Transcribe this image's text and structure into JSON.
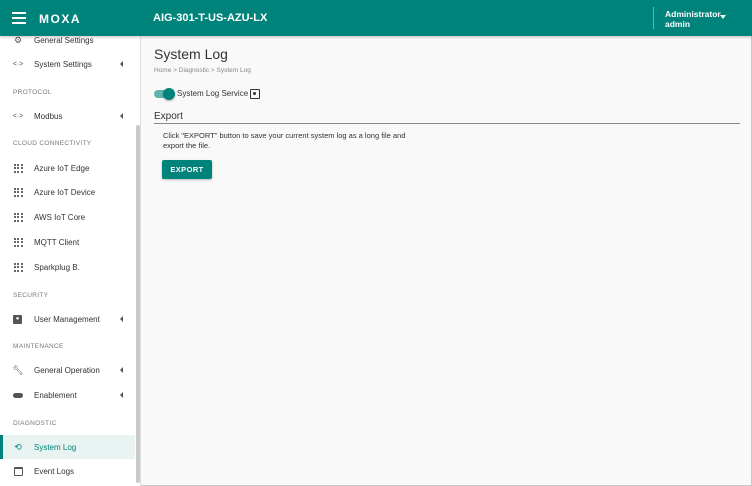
{
  "header": {
    "logo": "MOXA",
    "device_name": "AIG-301-T-US-AZU-LX",
    "user_role": "Administrator",
    "user_name": "admin"
  },
  "sidebar": {
    "items": [
      {
        "label": "General Settings",
        "icon": "gear-icon"
      },
      {
        "label": "System Settings",
        "icon": "code-icon"
      },
      {
        "section": "PROTOCOL"
      },
      {
        "label": "Modbus",
        "icon": "code-icon"
      },
      {
        "section": "CLOUD CONNECTIVITY"
      },
      {
        "label": "Azure IoT Edge",
        "icon": "grid-icon"
      },
      {
        "label": "Azure IoT Device",
        "icon": "grid-icon"
      },
      {
        "label": "AWS IoT Core",
        "icon": "grid-icon"
      },
      {
        "label": "MQTT Client",
        "icon": "grid-icon"
      },
      {
        "label": "Sparkplug B.",
        "icon": "grid-icon"
      },
      {
        "section": "SECURITY"
      },
      {
        "label": "User Management",
        "icon": "user-badge-icon"
      },
      {
        "section": "MAINTENANCE"
      },
      {
        "label": "General Operation",
        "icon": "wrench-icon"
      },
      {
        "label": "Enablement",
        "icon": "toggle-icon"
      },
      {
        "section": "DIAGNOSTIC"
      },
      {
        "label": "System Log",
        "icon": "history-icon",
        "active": true
      },
      {
        "label": "Event Logs",
        "icon": "calendar-icon"
      }
    ]
  },
  "main": {
    "title": "System Log",
    "breadcrumb": "Home > Diagnostic > System Log",
    "service_label": "System Log Service",
    "service_enabled": true,
    "export_section_title": "Export",
    "export_description": "Click \"EXPORT\" button to save your current system log as a long file and export the file.",
    "export_button": "EXPORT"
  },
  "colors": {
    "accent": "#00837a"
  }
}
